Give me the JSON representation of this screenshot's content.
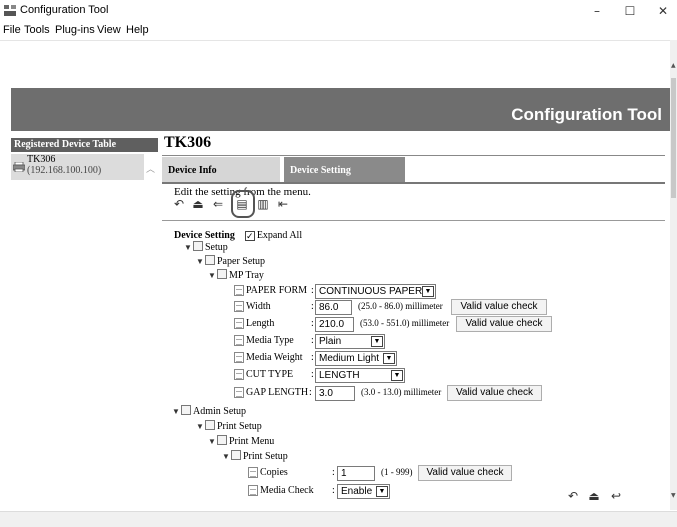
{
  "window": {
    "title": "Configuration Tool",
    "minimize_glyph": "–",
    "maximize_glyph": "☐",
    "close_glyph": "✕"
  },
  "menu": [
    "File",
    "Tools",
    "Plug-ins",
    "View",
    "Help"
  ],
  "banner": {
    "brand": "Configuration Tool"
  },
  "sidebar": {
    "header": "Registered Device Table",
    "device": {
      "name": "TK306",
      "ip": "(192.168.100.100)"
    }
  },
  "main": {
    "title": "TK306",
    "tabs": [
      {
        "label": "Device Info",
        "active": false
      },
      {
        "label": "Device Setting",
        "active": true
      }
    ],
    "instruction": "Edit the setting from the menu.",
    "toolbar_icons": [
      "undo-icon",
      "upload-icon",
      "back-icon",
      "copy-icon",
      "paste-icon",
      "first-icon"
    ],
    "highlighted_icon": "copy-icon"
  },
  "settings": {
    "heading": "Device Setting",
    "expand_all_label": "Expand All",
    "expand_all_checked": true,
    "nodes": {
      "setup": "Setup",
      "paper_setup": "Paper Setup",
      "mp_tray": "MP Tray",
      "admin_setup": "Admin Setup",
      "print_setup": "Print Setup",
      "print_menu": "Print Menu",
      "print_setup_sub": "Print Setup"
    },
    "fields": {
      "paper_form": {
        "label": "PAPER FORM",
        "value": "CONTINUOUS PAPER"
      },
      "width": {
        "label": "Width",
        "value": "86.0",
        "range": "(25.0 - 86.0) millimeter",
        "check": "Valid value check"
      },
      "length": {
        "label": "Length",
        "value": "210.0",
        "range": "(53.0 - 551.0) millimeter",
        "check": "Valid value check"
      },
      "media_type": {
        "label": "Media Type",
        "value": "Plain"
      },
      "media_weight": {
        "label": "Media Weight",
        "value": "Medium Light"
      },
      "cut_type": {
        "label": "CUT TYPE",
        "value": "LENGTH"
      },
      "gap_length": {
        "label": "GAP LENGTH",
        "value": "3.0",
        "range": "(3.0 - 13.0) millimeter",
        "check": "Valid value check"
      },
      "copies": {
        "label": "Copies",
        "value": "1",
        "range": "(1 - 999)",
        "check": "Valid value check"
      },
      "media_check": {
        "label": "Media Check",
        "value": "Enable"
      }
    },
    "colon": ":"
  },
  "footer_icons": [
    "undo-icon",
    "upload-icon",
    "back-icon"
  ]
}
